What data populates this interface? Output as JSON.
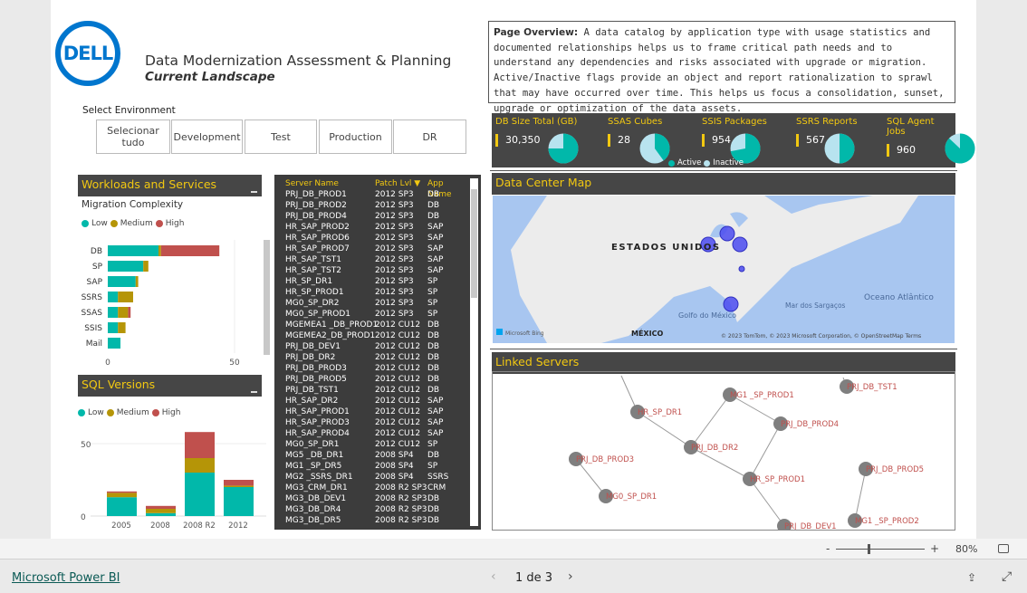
{
  "header": {
    "title": "Data Modernization Assessment & Planning",
    "subtitle": "Current Landscape",
    "logo_text": "DELL"
  },
  "overview": {
    "label": "Page Overview:",
    "text": " A data catalog by application type with usage statistics and documented relationships helps us to frame critical path needs and to understand any dependencies and risks associated with upgrade or migration. Active/Inactive flags provide an object and report rationalization to sprawl that may have occurred over time. This helps us focus a consolidation, sunset, upgrade or optimization of the data assets."
  },
  "environment": {
    "label": "Select Environment",
    "options": [
      "Selecionar tudo",
      "Development",
      "Test",
      "Production",
      "DR"
    ]
  },
  "colors": {
    "low": "#01b8aa",
    "medium": "#b59507",
    "high": "#c0504d",
    "active": "#01b8aa",
    "inactive": "#b8e3ef",
    "accent": "#f2c811",
    "header_bg": "#464646"
  },
  "workloads": {
    "title": "Workloads and Services",
    "subtitle": "Migration Complexity",
    "legend": [
      "Low",
      "Medium",
      "High"
    ],
    "chart_data": {
      "type": "bar",
      "orientation": "horizontal",
      "stacked": true,
      "categories": [
        "DB",
        "SP",
        "SAP",
        "SSRS",
        "SSAS",
        "SSIS",
        "Mail"
      ],
      "series": [
        {
          "name": "Low",
          "values": [
            20,
            14,
            11,
            4,
            4,
            4,
            5
          ]
        },
        {
          "name": "Medium",
          "values": [
            1,
            2,
            1,
            6,
            4,
            3,
            0
          ]
        },
        {
          "name": "High",
          "values": [
            23,
            0,
            0,
            0,
            1,
            0,
            0
          ]
        }
      ],
      "xticks": [
        "0",
        "50"
      ],
      "xlim": [
        0,
        60
      ]
    }
  },
  "sqlversions": {
    "title": "SQL Versions",
    "legend": [
      "Low",
      "Medium",
      "High"
    ],
    "chart_data": {
      "type": "bar",
      "stacked": true,
      "categories": [
        "2005",
        "2008",
        "2008 R2",
        "2012"
      ],
      "series": [
        {
          "name": "Low",
          "values": [
            13,
            2,
            30,
            20
          ]
        },
        {
          "name": "Medium",
          "values": [
            3,
            3,
            10,
            1
          ]
        },
        {
          "name": "High",
          "values": [
            1,
            2,
            18,
            4
          ]
        }
      ],
      "yticks": [
        "0",
        "50"
      ],
      "ylim": [
        0,
        60
      ]
    }
  },
  "table": {
    "headers": [
      "Server Name",
      "Patch Lvl",
      "App Name"
    ],
    "rows": [
      [
        "PRJ_DB_PROD1",
        "2012 SP3",
        "DB"
      ],
      [
        "PRJ_DB_PROD2",
        "2012 SP3",
        "DB"
      ],
      [
        "PRJ_DB_PROD4",
        "2012 SP3",
        "DB"
      ],
      [
        "HR_SAP_PROD2",
        "2012 SP3",
        "SAP"
      ],
      [
        "HR_SAP_PROD6",
        "2012 SP3",
        "SAP"
      ],
      [
        "HR_SAP_PROD7",
        "2012 SP3",
        "SAP"
      ],
      [
        "HR_SAP_TST1",
        "2012 SP3",
        "SAP"
      ],
      [
        "HR_SAP_TST2",
        "2012 SP3",
        "SAP"
      ],
      [
        "HR_SP_DR1",
        "2012 SP3",
        "SP"
      ],
      [
        "HR_SP_PROD1",
        "2012 SP3",
        "SP"
      ],
      [
        "MG0_SP_DR2",
        "2012 SP3",
        "SP"
      ],
      [
        "MG0_SP_PROD1",
        "2012 SP3",
        "SP"
      ],
      [
        "MGEMEA1 _DB_PROD1",
        "2012 CU12",
        "DB"
      ],
      [
        "MGEMEA2_DB_PROD1",
        "2012 CU12",
        "DB"
      ],
      [
        "PRJ_DB_DEV1",
        "2012 CU12",
        "DB"
      ],
      [
        "PRJ_DB_DR2",
        "2012 CU12",
        "DB"
      ],
      [
        "PRJ_DB_PROD3",
        "2012 CU12",
        "DB"
      ],
      [
        "PRJ_DB_PROD5",
        "2012 CU12",
        "DB"
      ],
      [
        "PRJ_DB_TST1",
        "2012 CU12",
        "DB"
      ],
      [
        "HR_SAP_DR2",
        "2012 CU12",
        "SAP"
      ],
      [
        "HR_SAP_PROD1",
        "2012 CU12",
        "SAP"
      ],
      [
        "HR_SAP_PROD3",
        "2012 CU12",
        "SAP"
      ],
      [
        "HR_SAP_PROD4",
        "2012 CU12",
        "SAP"
      ],
      [
        "MG0_SP_DR1",
        "2012 CU12",
        "SP"
      ],
      [
        "MG5 _DB_DR1",
        "2008 SP4",
        "DB"
      ],
      [
        "MG1 _SP_DR5",
        "2008 SP4",
        "SP"
      ],
      [
        "MG2 _SSRS_DR1",
        "2008 SP4",
        "SSRS"
      ],
      [
        "MG3_CRM_DR1",
        "2008 R2 SP3",
        "CRM"
      ],
      [
        "MG3_DB_DEV1",
        "2008 R2 SP3",
        "DB"
      ],
      [
        "MG3_DB_DR4",
        "2008 R2 SP3",
        "DB"
      ],
      [
        "MG3_DB_DR5",
        "2008 R2 SP3",
        "DB"
      ]
    ]
  },
  "kpis": [
    {
      "title": "DB Size Total (GB)",
      "value": "30,350",
      "active_pct": 75
    },
    {
      "title": "SSAS Cubes",
      "value": "28",
      "active_pct": 40
    },
    {
      "title": "SSIS Packages",
      "value": "954",
      "active_pct": 72
    },
    {
      "title": "SSRS Reports",
      "value": "567",
      "active_pct": 50
    },
    {
      "title": "SQL Agent Jobs",
      "value": "960",
      "active_pct": 87
    }
  ],
  "kpi_legend": [
    "Active",
    "Inactive"
  ],
  "map": {
    "title": "Data Center Map",
    "labels": {
      "country": "ESTADOS UNIDOS",
      "mexico": "MÉXICO",
      "gulf": "Golfo do México",
      "sargasso": "Mar dos Sargaços",
      "ocean": "Oceano Atlântico"
    },
    "attribution": "© 2023 TomTom, © 2023 Microsoft Corporation, © OpenStreetMap  Terms",
    "bing": "Microsoft Bing"
  },
  "linked": {
    "title": "Linked Servers",
    "nodes": [
      "HR_SP_DR1",
      "MG1 _SP_PROD1",
      "PRJ_DB_TST1",
      "PRJ_DB_PROD4",
      "PRJ_DB_DR2",
      "PRJ_DB_PROD3",
      "HR_SP_PROD1",
      "PRJ_DB_PROD5",
      "MG0_SP_DR1",
      "PRJ_DB_DEV1",
      "MG1 _SP_PROD2"
    ]
  },
  "zoombar": {
    "minus": "-",
    "plus": "+",
    "zoom": "80%",
    "zoom_level": 80
  },
  "footer": {
    "brand": "Microsoft Power BI",
    "page": "1 de 3"
  }
}
